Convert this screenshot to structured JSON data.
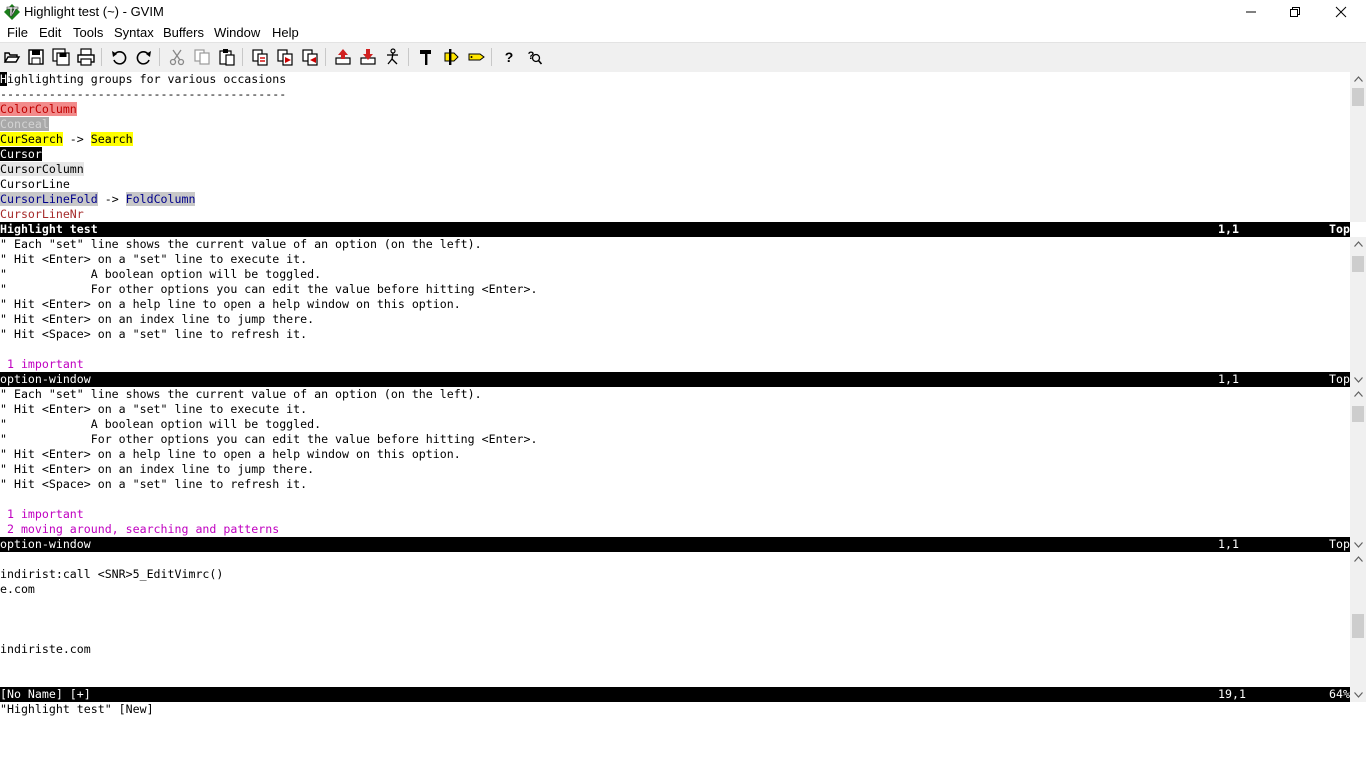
{
  "window": {
    "title": "Highlight test (~) - GVIM",
    "icon": "vim-icon",
    "controls": [
      "minimize-icon",
      "restore-icon",
      "close-icon"
    ]
  },
  "menu": [
    "File",
    "Edit",
    "Tools",
    "Syntax",
    "Buffers",
    "Window",
    "Help"
  ],
  "toolbar": {
    "buttons": [
      "open-icon",
      "save-icon",
      "save-all-icon",
      "print-icon",
      "undo-icon",
      "redo-icon",
      "cut-icon",
      "copy-icon",
      "paste-icon",
      "replace-icon",
      "find-next-icon",
      "find-prev-icon",
      "load-session-icon",
      "save-session-icon",
      "run-script-icon",
      "make-icon",
      "build-tags-icon",
      "jump-tag-icon",
      "help-icon",
      "find-help-icon"
    ]
  },
  "win1": {
    "heading_rest": "ighlighting groups for various occasions",
    "heading_first": "H",
    "rule": "-----------------------------------------",
    "colorcolumn": "ColorColumn",
    "conceal": "Conceal",
    "cursearch": "CurSearch",
    "arrow": " -> ",
    "search": "Search",
    "cursor": "Cursor",
    "cursorcolumn": "CursorColumn",
    "cursorline": "CursorLine",
    "cursorlinefold": "CursorLineFold",
    "foldcolumn": "FoldColumn",
    "cursorlinenr": "CursorLineNr",
    "status_name": "Highlight test",
    "status_pos": "1,1",
    "status_pct": "Top"
  },
  "win2": {
    "lines": [
      "\" Each \"set\" line shows the current value of an option (on the left).",
      "\" Hit <Enter> on a \"set\" line to execute it.",
      "\"            A boolean option will be toggled.",
      "\"            For other options you can edit the value before hitting <Enter>.",
      "\" Hit <Enter> on a help line to open a help window on this option.",
      "\" Hit <Enter> on an index line to jump there.",
      "\" Hit <Space> on a \"set\" line to refresh it."
    ],
    "section1": " 1 important",
    "status_name": "option-window",
    "status_pos": "1,1",
    "status_pct": "Top"
  },
  "win3": {
    "lines": [
      "\" Each \"set\" line shows the current value of an option (on the left).",
      "\" Hit <Enter> on a \"set\" line to execute it.",
      "\"            A boolean option will be toggled.",
      "\"            For other options you can edit the value before hitting <Enter>.",
      "\" Hit <Enter> on a help line to open a help window on this option.",
      "\" Hit <Enter> on an index line to jump there.",
      "\" Hit <Space> on a \"set\" line to refresh it."
    ],
    "section1": " 1 important",
    "section2": " 2 moving around, searching and patterns",
    "status_name": "option-window",
    "status_pos": "1,1",
    "status_pct": "Top"
  },
  "win4": {
    "line1": "indirist:call <SNR>5_EditVimrc()",
    "line2": "e.com",
    "line3": "indiriste.com",
    "status_name": "[No Name] [+]",
    "status_pos": "19,1",
    "status_pct": "64%"
  },
  "cmdline": "\"Highlight test\" [New]"
}
